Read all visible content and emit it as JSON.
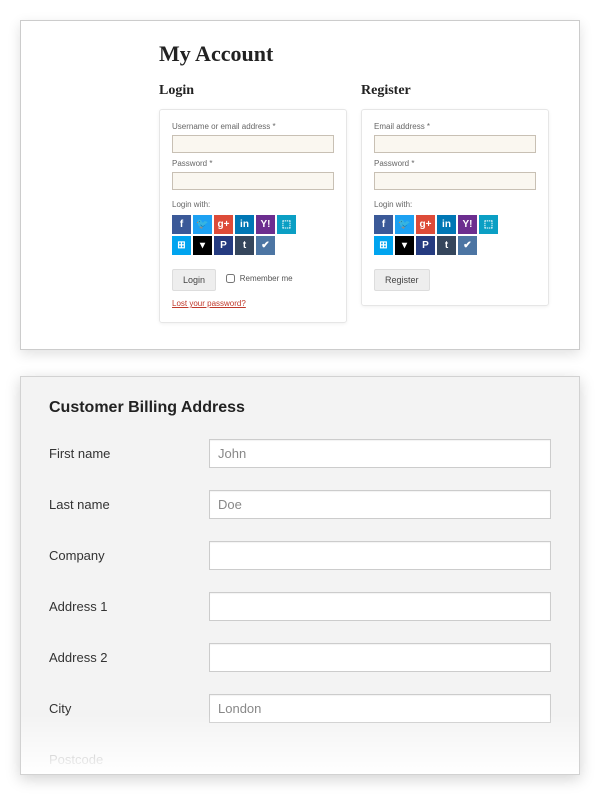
{
  "account": {
    "title": "My Account",
    "login": {
      "heading": "Login",
      "username_label": "Username or email address *",
      "password_label": "Password *",
      "login_with": "Login with:",
      "button": "Login",
      "remember": "Remember me",
      "lost": "Lost your password?"
    },
    "register": {
      "heading": "Register",
      "email_label": "Email address *",
      "password_label": "Password *",
      "login_with": "Login with:",
      "button": "Register"
    },
    "social_icons": {
      "fb": "f",
      "tw": "🐦",
      "gp": "g+",
      "in": "in",
      "yh": "Y!",
      "fs": "⬚",
      "ms": "⊞",
      "st": "▾",
      "pp": "P",
      "tm": "t",
      "vk": "✔"
    }
  },
  "billing": {
    "heading": "Customer Billing Address",
    "fields": {
      "first_name": {
        "label": "First name",
        "value": "John"
      },
      "last_name": {
        "label": "Last name",
        "value": "Doe"
      },
      "company": {
        "label": "Company",
        "value": ""
      },
      "address1": {
        "label": "Address 1",
        "value": ""
      },
      "address2": {
        "label": "Address 2",
        "value": ""
      },
      "city": {
        "label": "City",
        "value": "London"
      },
      "postcode": {
        "label": "Postcode",
        "value": ""
      }
    }
  }
}
